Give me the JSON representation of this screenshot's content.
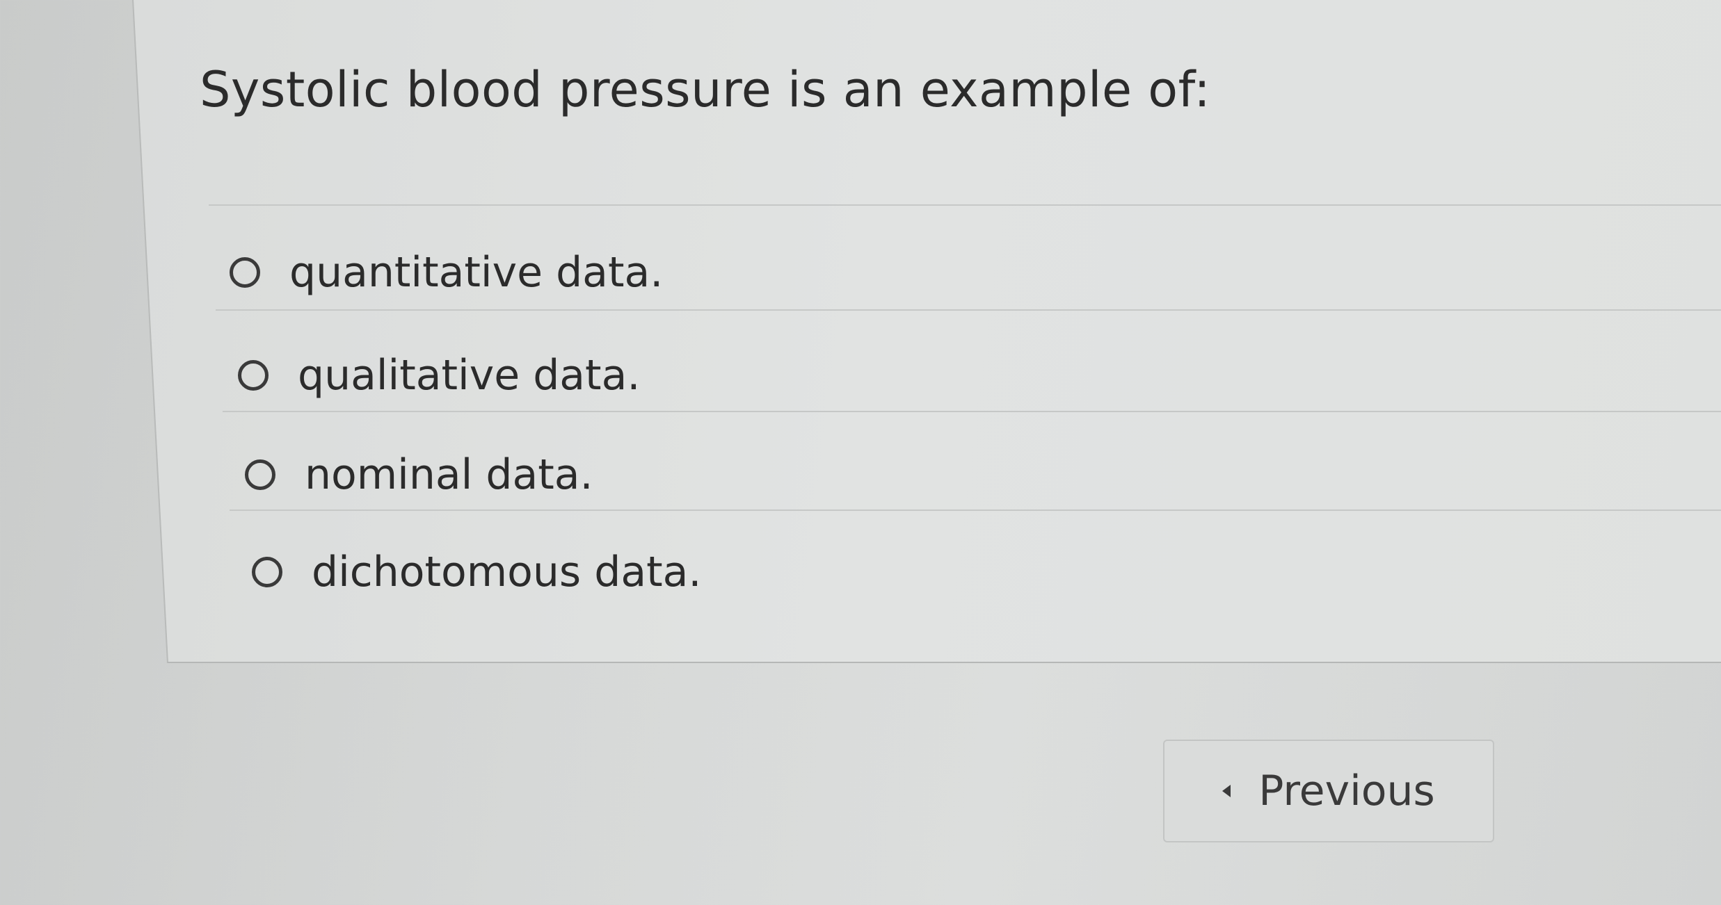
{
  "question": {
    "text": "Systolic blood pressure is an example of:"
  },
  "options": [
    {
      "label": "quantitative data.",
      "selected": false
    },
    {
      "label": "qualitative data.",
      "selected": false
    },
    {
      "label": "nominal data.",
      "selected": false
    },
    {
      "label": "dichotomous data.",
      "selected": false
    }
  ],
  "navigation": {
    "previous_label": "Previous"
  }
}
